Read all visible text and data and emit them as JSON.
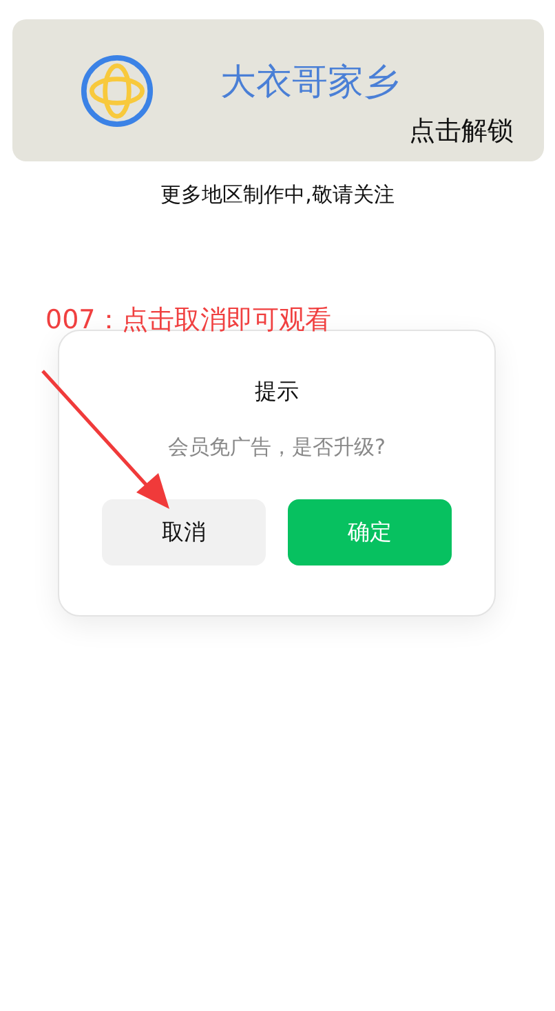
{
  "banner": {
    "title": "大衣哥家乡",
    "action": "点击解锁"
  },
  "notice": "更多地区制作中,敬请关注",
  "annotation": "007：点击取消即可观看",
  "dialog": {
    "title": "提示",
    "message": "会员免广告，是否升级?",
    "buttons": [
      {
        "label": "取消",
        "kind": "secondary"
      },
      {
        "label": "确定",
        "kind": "primary"
      }
    ]
  }
}
